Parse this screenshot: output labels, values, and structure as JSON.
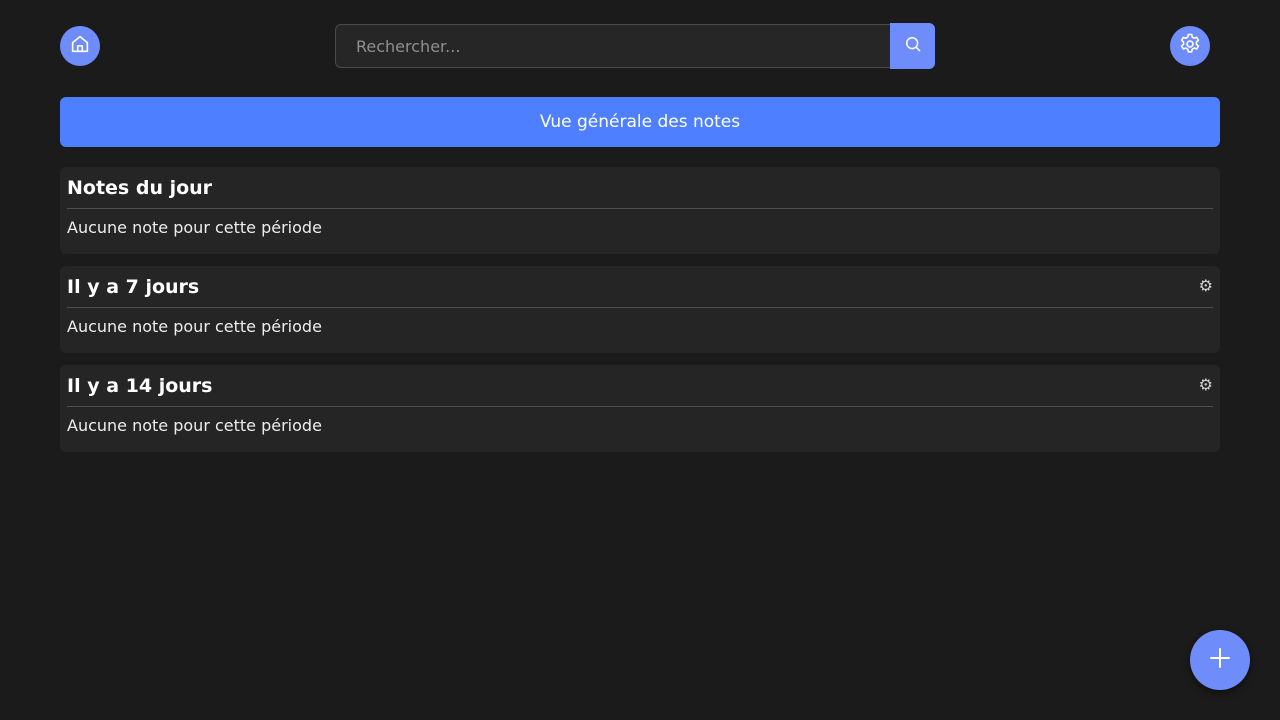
{
  "header": {
    "home_icon": "home-icon",
    "settings_icon": "gear-icon",
    "search": {
      "placeholder": "Rechercher...",
      "value": "",
      "icon": "search-icon"
    }
  },
  "overview": {
    "label": "Vue générale des notes"
  },
  "sections": [
    {
      "title": "Notes du jour",
      "empty_text": "Aucune note pour cette période",
      "has_settings": false
    },
    {
      "title": "Il y a 7 jours",
      "empty_text": "Aucune note pour cette période",
      "has_settings": true,
      "settings_glyph": "⚙"
    },
    {
      "title": "Il y a 14 jours",
      "empty_text": "Aucune note pour cette période",
      "has_settings": true,
      "settings_glyph": "⚙"
    }
  ],
  "fab": {
    "icon": "plus-icon"
  },
  "colors": {
    "accent": "#6e8dfb",
    "primary_button": "#4d7fff",
    "background": "#1b1b1b",
    "card": "#252525"
  }
}
